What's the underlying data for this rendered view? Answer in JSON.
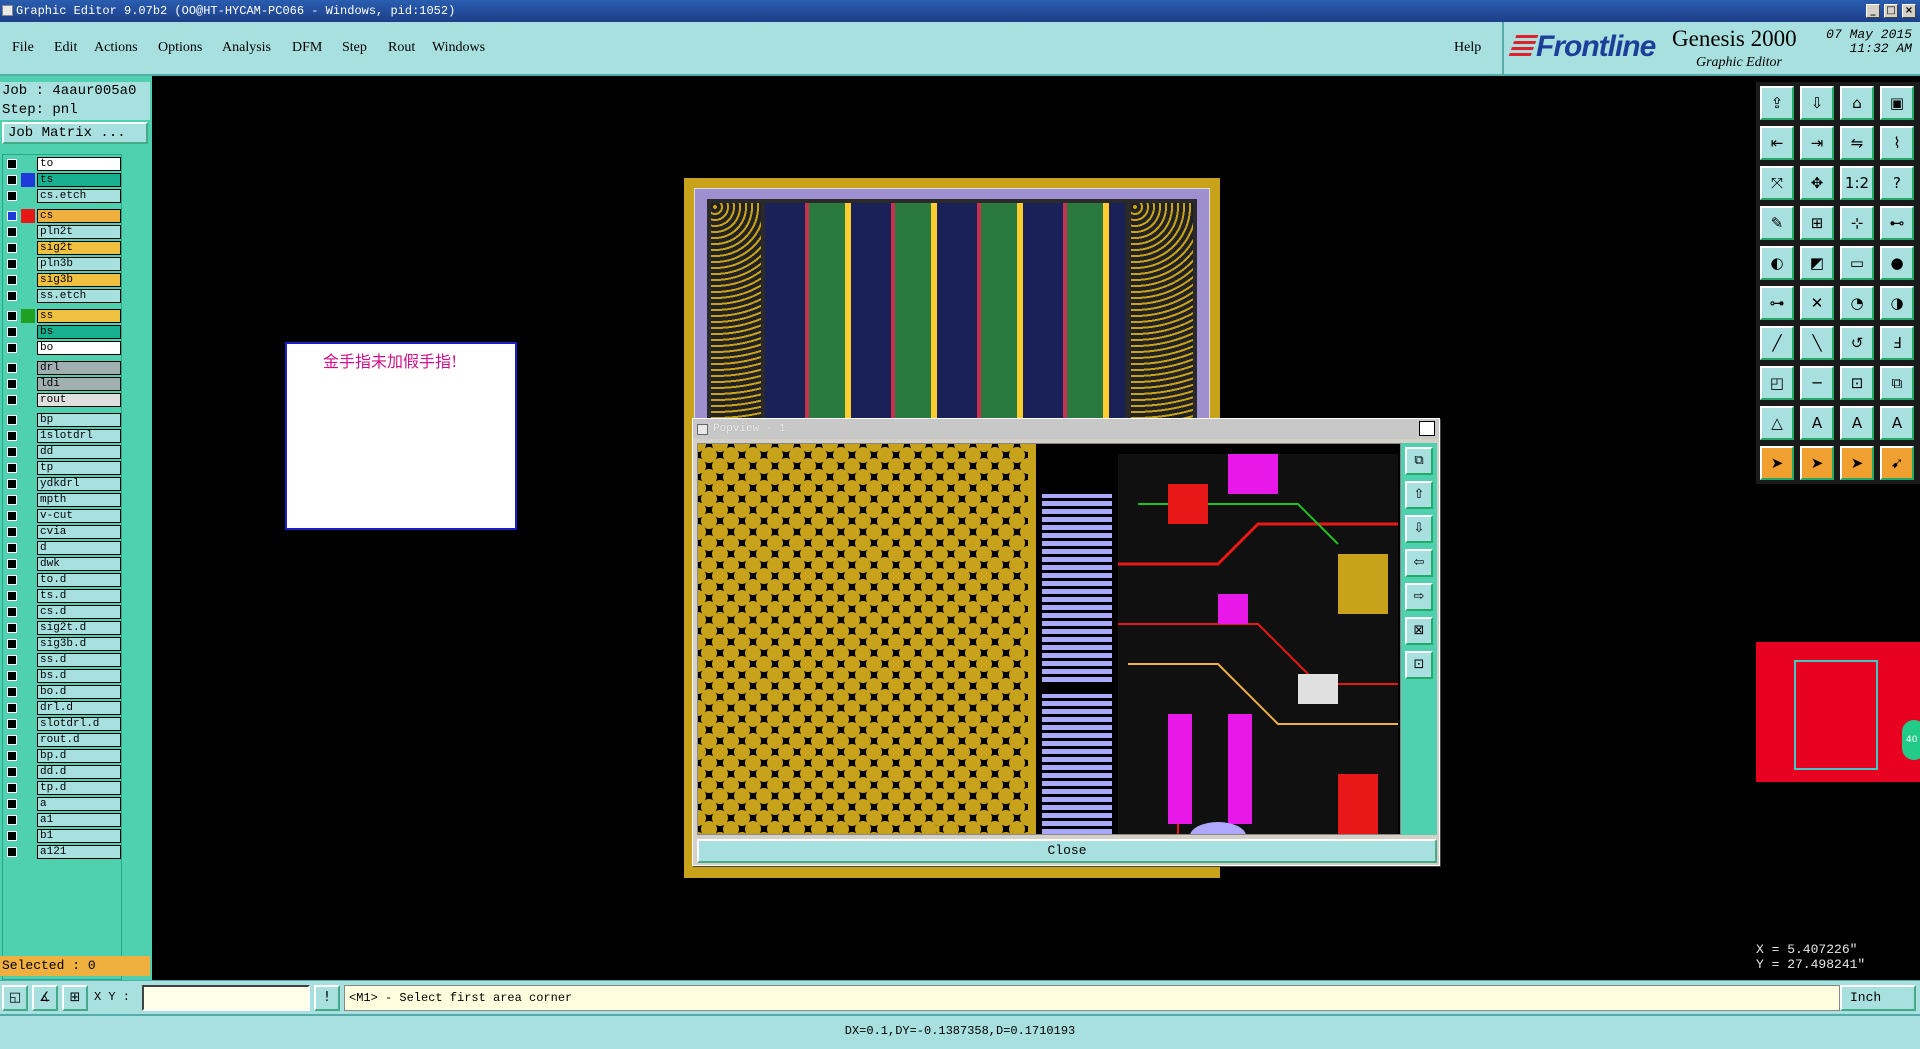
{
  "window": {
    "title": "Graphic Editor 9.07b2 (OO@HT-HYCAM-PC066 - Windows, pid:1052)"
  },
  "menu": {
    "items": [
      {
        "label": "File"
      },
      {
        "label": "Edit"
      },
      {
        "label": "Actions"
      },
      {
        "label": "Options"
      },
      {
        "label": "Analysis"
      },
      {
        "label": "DFM"
      },
      {
        "label": "Step"
      },
      {
        "label": "Rout"
      },
      {
        "label": "Windows"
      }
    ],
    "help": "Help"
  },
  "brand": {
    "logo": "Frontline",
    "product": "Genesis 2000",
    "subtitle": "Graphic Editor",
    "date": "07 May 2015",
    "time": "11:32 AM"
  },
  "job": {
    "job_line": "Job : 4aaur005a0",
    "step_line": "Step: pnl",
    "matrix_button": "Job Matrix ..."
  },
  "layers": [
    {
      "name": "to",
      "color": "",
      "name_bg": "#ffffff"
    },
    {
      "name": "ts",
      "color": "#1e3ad8",
      "name_bg": "#18b090"
    },
    {
      "name": "cs.etch",
      "color": "",
      "name_bg": ""
    },
    {
      "name": "cs",
      "color": "#e81818",
      "name_bg": "#f0b040",
      "active": true
    },
    {
      "name": "pln2t",
      "color": "",
      "name_bg": ""
    },
    {
      "name": "sig2t",
      "color": "",
      "name_bg": "#f0c040"
    },
    {
      "name": "pln3b",
      "color": "",
      "name_bg": ""
    },
    {
      "name": "sig3b",
      "color": "",
      "name_bg": "#f0c040"
    },
    {
      "name": "ss.etch",
      "color": "",
      "name_bg": ""
    },
    {
      "name": "ss",
      "color": "#20a020",
      "name_bg": "#f0c040"
    },
    {
      "name": "bs",
      "color": "",
      "name_bg": "#18b090"
    },
    {
      "name": "bo",
      "color": "",
      "name_bg": "#ffffff"
    },
    {
      "name": "drl",
      "color": "",
      "name_bg": "#a0b0b0"
    },
    {
      "name": "ldi",
      "color": "",
      "name_bg": "#a0b0b0"
    },
    {
      "name": "rout",
      "color": "",
      "name_bg": "#e0e0e0"
    },
    {
      "name": "bp",
      "color": "",
      "name_bg": ""
    },
    {
      "name": "1slotdrl",
      "color": "",
      "name_bg": ""
    },
    {
      "name": "dd",
      "color": "",
      "name_bg": ""
    },
    {
      "name": "tp",
      "color": "",
      "name_bg": ""
    },
    {
      "name": "ydkdrl",
      "color": "",
      "name_bg": ""
    },
    {
      "name": "mpth",
      "color": "",
      "name_bg": ""
    },
    {
      "name": "v-cut",
      "color": "",
      "name_bg": ""
    },
    {
      "name": "cvia",
      "color": "",
      "name_bg": ""
    },
    {
      "name": "d",
      "color": "",
      "name_bg": ""
    },
    {
      "name": "dwk",
      "color": "",
      "name_bg": ""
    },
    {
      "name": "to.d",
      "color": "",
      "name_bg": ""
    },
    {
      "name": "ts.d",
      "color": "",
      "name_bg": ""
    },
    {
      "name": "cs.d",
      "color": "",
      "name_bg": ""
    },
    {
      "name": "sig2t.d",
      "color": "",
      "name_bg": ""
    },
    {
      "name": "sig3b.d",
      "color": "",
      "name_bg": ""
    },
    {
      "name": "ss.d",
      "color": "",
      "name_bg": ""
    },
    {
      "name": "bs.d",
      "color": "",
      "name_bg": ""
    },
    {
      "name": "bo.d",
      "color": "",
      "name_bg": ""
    },
    {
      "name": "drl.d",
      "color": "",
      "name_bg": ""
    },
    {
      "name": "slotdrl.d",
      "color": "",
      "name_bg": ""
    },
    {
      "name": "rout.d",
      "color": "",
      "name_bg": ""
    },
    {
      "name": "bp.d",
      "color": "",
      "name_bg": ""
    },
    {
      "name": "dd.d",
      "color": "",
      "name_bg": ""
    },
    {
      "name": "tp.d",
      "color": "",
      "name_bg": ""
    },
    {
      "name": "a",
      "color": "",
      "name_bg": ""
    },
    {
      "name": "a1",
      "color": "",
      "name_bg": ""
    },
    {
      "name": "b1",
      "color": "",
      "name_bg": ""
    },
    {
      "name": "a121",
      "color": "",
      "name_bg": ""
    }
  ],
  "selected": "Selected : 0",
  "memo": {
    "text": "金手指未加假手指!"
  },
  "popview": {
    "title": "Popview - 1",
    "close_label": "Close"
  },
  "cmd": {
    "xy_label": "X Y :",
    "xy_value": "",
    "prompt": "<M1> - Select first area corner",
    "units": "Inch"
  },
  "coords": {
    "x": "X = 5.407226\"",
    "y": "Y = 27.498241\""
  },
  "zoom_knob": "40",
  "status": "DX=0.1,DY=-0.1387358,D=0.1710193",
  "tools": {
    "icons": [
      "layer-up-icon",
      "layer-down-icon",
      "home-icon",
      "window-icon",
      "step-in-icon",
      "step-out-icon",
      "swap-icon",
      "snap-icon",
      "zoom-fit-icon",
      "zoom-move-icon",
      "one-to-one-icon",
      "help-icon",
      "measure-icon",
      "grid-icon",
      "drill-icon",
      "net-icon",
      "pad-icon",
      "shape-icon",
      "ruler-icon",
      "dot-icon",
      "connect-icon",
      "cross-icon",
      "arc-node-icon",
      "line-node-icon",
      "line-add-icon",
      "diag-line-icon",
      "curve-icon",
      "text-icon",
      "select-node-icon",
      "hline-icon",
      "resize-icon",
      "group-icon",
      "triangle-icon",
      "triangle-a-icon",
      "triangle-b-icon",
      "triangle-c-icon",
      "pointer-icon",
      "pointer-select-icon",
      "pointer-rotate-icon",
      "pointer-edit-icon"
    ]
  }
}
